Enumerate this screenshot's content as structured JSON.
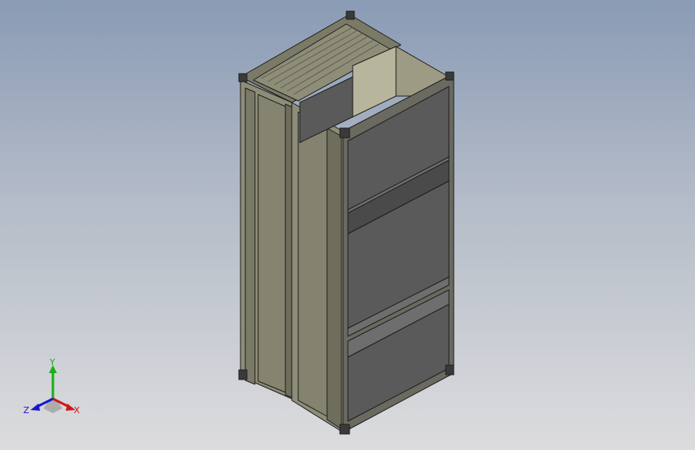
{
  "viewport": {
    "background_top": "#8a9bb5",
    "background_bottom": "#dcdcde"
  },
  "model": {
    "description_icon": "cabinet-3d-model",
    "colors": {
      "frame_light": "#8e8d78",
      "frame_mid": "#7b7a67",
      "frame_dark": "#5f5e4f",
      "panel_dark": "#5a5a5a",
      "panel_shadow": "#444444",
      "inner_light": "#b8b59d",
      "edge": "#1e1e1e"
    }
  },
  "triad": {
    "x_label": "X",
    "y_label": "Y",
    "z_label": "Z",
    "x_color": "#d01818",
    "y_color": "#18b018",
    "z_color": "#1818d0"
  }
}
